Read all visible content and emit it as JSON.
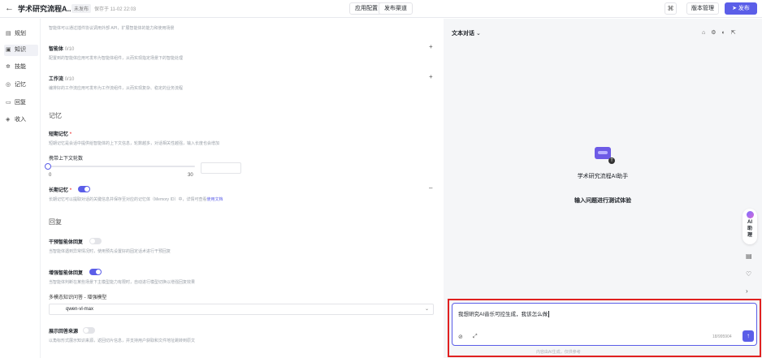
{
  "topbar": {
    "back_icon": "arrow-left-icon",
    "title": "学术研究流程A...",
    "badge": "未发布",
    "saved": "保存于 11-02 22:03",
    "tabs": [
      "应用配置",
      "发布渠道"
    ],
    "grid_icon": "grid-icon",
    "version_label": "版本管理",
    "publish_label": "发布"
  },
  "sidebar": {
    "items": [
      {
        "icon": "plan-icon",
        "label": "规划"
      },
      {
        "icon": "knowledge-icon",
        "label": "知识"
      },
      {
        "icon": "skill-icon",
        "label": "技能"
      },
      {
        "icon": "memory-icon",
        "label": "记忆"
      },
      {
        "icon": "reply-icon",
        "label": "回复"
      },
      {
        "icon": "income-icon",
        "label": "收入"
      }
    ]
  },
  "config": {
    "plugin_desc": "智能体可以通过插件协议调用外部 API，扩展智能体的能力和使用场景",
    "agent": {
      "title": "智能体",
      "count": "0/10",
      "desc": "配置到的智能体应用可发布为智能体组件，从而实现指定场景下的智能处理"
    },
    "workflow": {
      "title": "工作流",
      "count": "0/10",
      "desc": "编排好的工作流应用可发布为工作流组件，从而实现复杂、稳定的业务流程"
    },
    "memory_section": "记忆",
    "short_memory": {
      "title": "短期记忆",
      "desc": "短期记忆是会话中提供给智能体的上下文信息，轮数越多，对话相关性越强，输入长度也会增加"
    },
    "context_rounds": {
      "label": "携带上下文轮数",
      "min": "0",
      "max": "30"
    },
    "long_memory": {
      "title": "长期记忆",
      "desc": "长期记忆可以提取对话的关键信息并保存至对应的记忆体（Memory ID）中，详情可查看",
      "link": "使用文档"
    },
    "reply_section": "回复",
    "intervene": {
      "title": "干预智能体回复",
      "desc": "当智能体遇到异常情况时，使用预先设置好的固定话术进行干预回复"
    },
    "enhance": {
      "title": "增强智能体回复",
      "desc": "当智能体判断在某些场景下主模型能力有限时，自动进行模型切换以增强回复效果"
    },
    "model_label": "多模态知识问答 - 增强模型",
    "model_value": "qwen-vl-max",
    "source": {
      "title": "展示回答来源",
      "desc": "以角标形式展示知识来源，返回切片信息，并支持用户获取和文件地址跳转到原文"
    }
  },
  "chat": {
    "title": "文本对话",
    "bot_name": "学术研究流程AI助手",
    "hint": "输入问题进行测试体验",
    "ai_help": [
      "AI",
      "助",
      "理"
    ],
    "input_text": "我想研究AI音乐可控生成，我该怎么做",
    "char_count": "18/995904",
    "disclaimer": "内容由AI生成，仅供参考"
  }
}
